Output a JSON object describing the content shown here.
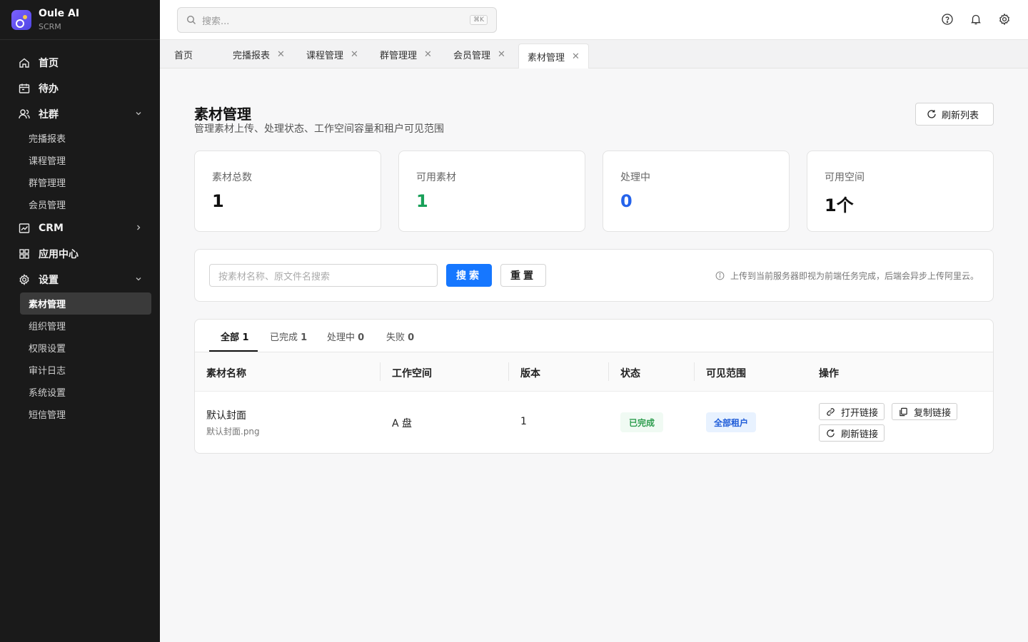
{
  "brand": {
    "name": "Oule AI",
    "sub": "SCRM"
  },
  "sidebar": {
    "home": "首页",
    "todo": "待办",
    "community": "社群",
    "community_items": [
      "完播报表",
      "课程管理",
      "群管理理",
      "会员管理"
    ],
    "crm": "CRM",
    "app_center": "应用中心",
    "settings": "设置",
    "settings_items": [
      "素材管理",
      "组织管理",
      "权限设置",
      "审计日志",
      "系统设置",
      "短信管理"
    ]
  },
  "topbar": {
    "search_placeholder": "搜索...",
    "shortcut": "⌘K"
  },
  "tabs": [
    "首页",
    "完播报表",
    "课程管理",
    "群管理理",
    "会员管理",
    "素材管理"
  ],
  "page": {
    "title": "素材管理",
    "desc": "管理素材上传、处理状态、工作空间容量和租户可见范围",
    "refresh": "刷新列表"
  },
  "stats": [
    {
      "label": "素材总数",
      "value": "1"
    },
    {
      "label": "可用素材",
      "value": "1"
    },
    {
      "label": "处理中",
      "value": "0"
    },
    {
      "label": "可用空间",
      "value": "1个"
    }
  ],
  "filter": {
    "placeholder": "按素材名称、原文件名搜索",
    "search": "搜索",
    "reset": "重置",
    "hint": "上传到当前服务器即视为前端任务完成，后端会异步上传阿里云。"
  },
  "filter_tabs": [
    {
      "label": "全部",
      "count": "1"
    },
    {
      "label": "已完成",
      "count": "1"
    },
    {
      "label": "处理中",
      "count": "0"
    },
    {
      "label": "失败",
      "count": "0"
    }
  ],
  "table": {
    "headers": [
      "素材名称",
      "工作空间",
      "版本",
      "状态",
      "可见范围",
      "操作"
    ],
    "rows": [
      {
        "name": "默认封面",
        "file": "默认封面.png",
        "workspace": "A 盘",
        "version": "1",
        "status": "已完成",
        "scope": "全部租户"
      }
    ],
    "actions": {
      "open": "打开链接",
      "copy": "复制链接",
      "refresh": "刷新链接"
    }
  },
  "colors": {
    "primary": "#1677ff",
    "success": "#18a058",
    "processing": "#2563eb",
    "sidebar_bg": "#1a1a1a"
  }
}
